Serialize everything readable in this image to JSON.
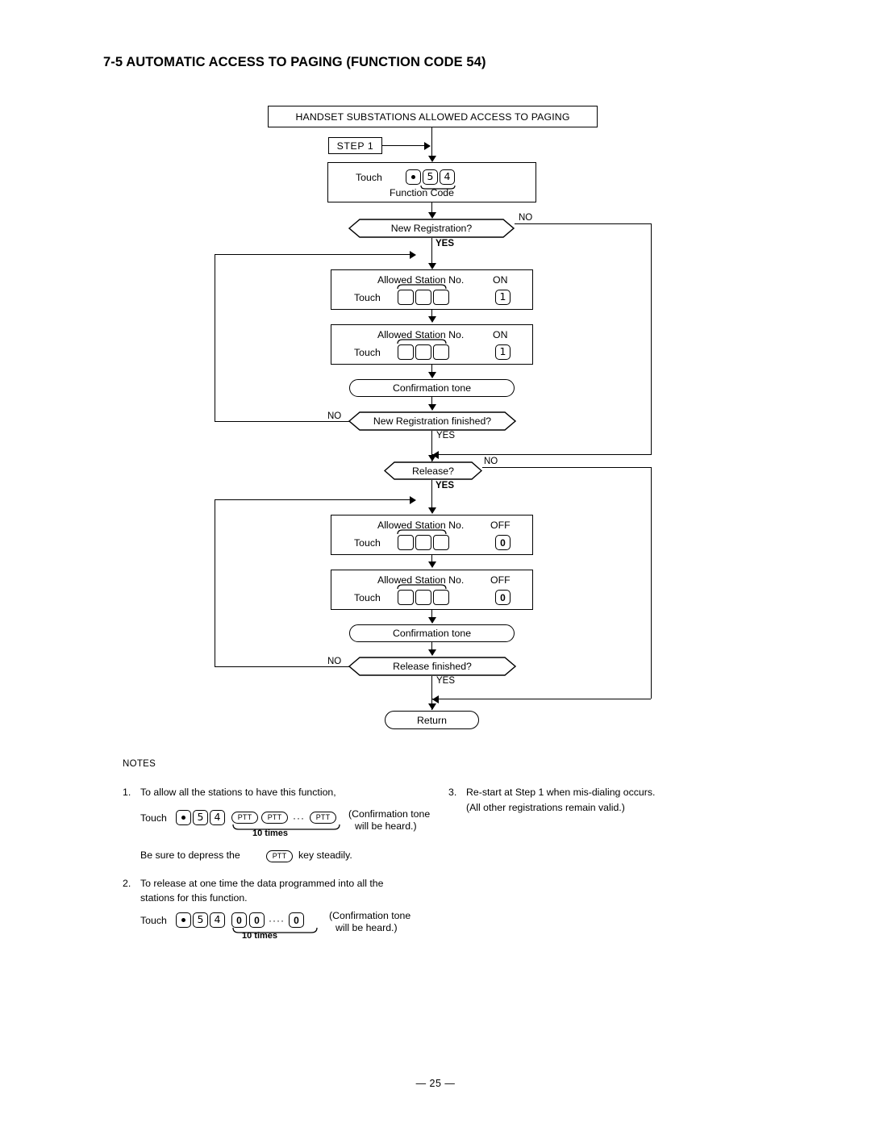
{
  "page": {
    "title": "7-5 AUTOMATIC ACCESS TO PAGING (FUNCTION CODE 54)",
    "number": "— 25 —"
  },
  "flowchart": {
    "header": "HANDSET SUBSTATIONS ALLOWED ACCESS TO PAGING",
    "step": "STEP 1",
    "function_code_block": {
      "touch_label": "Touch",
      "keys": [
        "•",
        "5",
        "4"
      ],
      "caption": "Function Code"
    },
    "decisions": [
      {
        "id": "new-registration",
        "text": "New Registration?",
        "no": "NO",
        "yes": "YES"
      },
      {
        "id": "new-registration-finished",
        "text": "New Registration finished?",
        "no": "NO",
        "yes": "YES"
      },
      {
        "id": "release",
        "text": "Release?",
        "no": "NO",
        "yes": "YES"
      },
      {
        "id": "release-finished",
        "text": "Release finished?",
        "no": "NO",
        "yes": "YES"
      }
    ],
    "station_blocks": [
      {
        "id": "on-1",
        "title": "Allowed Station No.",
        "touch_label": "Touch",
        "blank_keys": 3,
        "state": "ON",
        "state_key": "1"
      },
      {
        "id": "on-2",
        "title": "Allowed Station No.",
        "touch_label": "Touch",
        "blank_keys": 3,
        "state": "ON",
        "state_key": "1"
      },
      {
        "id": "off-1",
        "title": "Allowed Station No.",
        "touch_label": "Touch",
        "blank_keys": 3,
        "state": "OFF",
        "state_key": "0"
      },
      {
        "id": "off-2",
        "title": "Allowed Station No.",
        "touch_label": "Touch",
        "blank_keys": 3,
        "state": "OFF",
        "state_key": "0"
      }
    ],
    "tones": [
      {
        "id": "tone-1",
        "text": "Confirmation tone"
      },
      {
        "id": "tone-2",
        "text": "Confirmation tone"
      }
    ],
    "terminator": "Return"
  },
  "notes": {
    "heading": "NOTES",
    "items": [
      {
        "num": "1.",
        "line1": "To allow all the stations to have this function,",
        "touch_label": "Touch",
        "keys": [
          "•",
          "5",
          "4"
        ],
        "ptt_keys": [
          "PTT",
          "PTT",
          "PTT"
        ],
        "ellipsis": "···",
        "repeat": "10 times",
        "paren_line1": "(Confirmation tone",
        "paren_line2": "will be heard.)",
        "footer_pre": "Be sure to depress the",
        "footer_key": "PTT",
        "footer_post": "key steadily."
      },
      {
        "num": "2.",
        "line1": "To release at one time the data programmed into all the",
        "line2": "stations for this function.",
        "touch_label": "Touch",
        "keys": [
          "•",
          "5",
          "4"
        ],
        "zero_keys": [
          "0",
          "0",
          "0"
        ],
        "ellipsis": "····",
        "repeat": "10 times",
        "paren_line1": "(Confirmation tone",
        "paren_line2": "will be heard.)"
      },
      {
        "num": "3.",
        "line1": "Re-start at Step 1 when mis-dialing occurs.",
        "line2": "(All other registrations remain valid.)"
      }
    ]
  },
  "colors": {
    "ink": "#000000",
    "paper": "#ffffff"
  }
}
